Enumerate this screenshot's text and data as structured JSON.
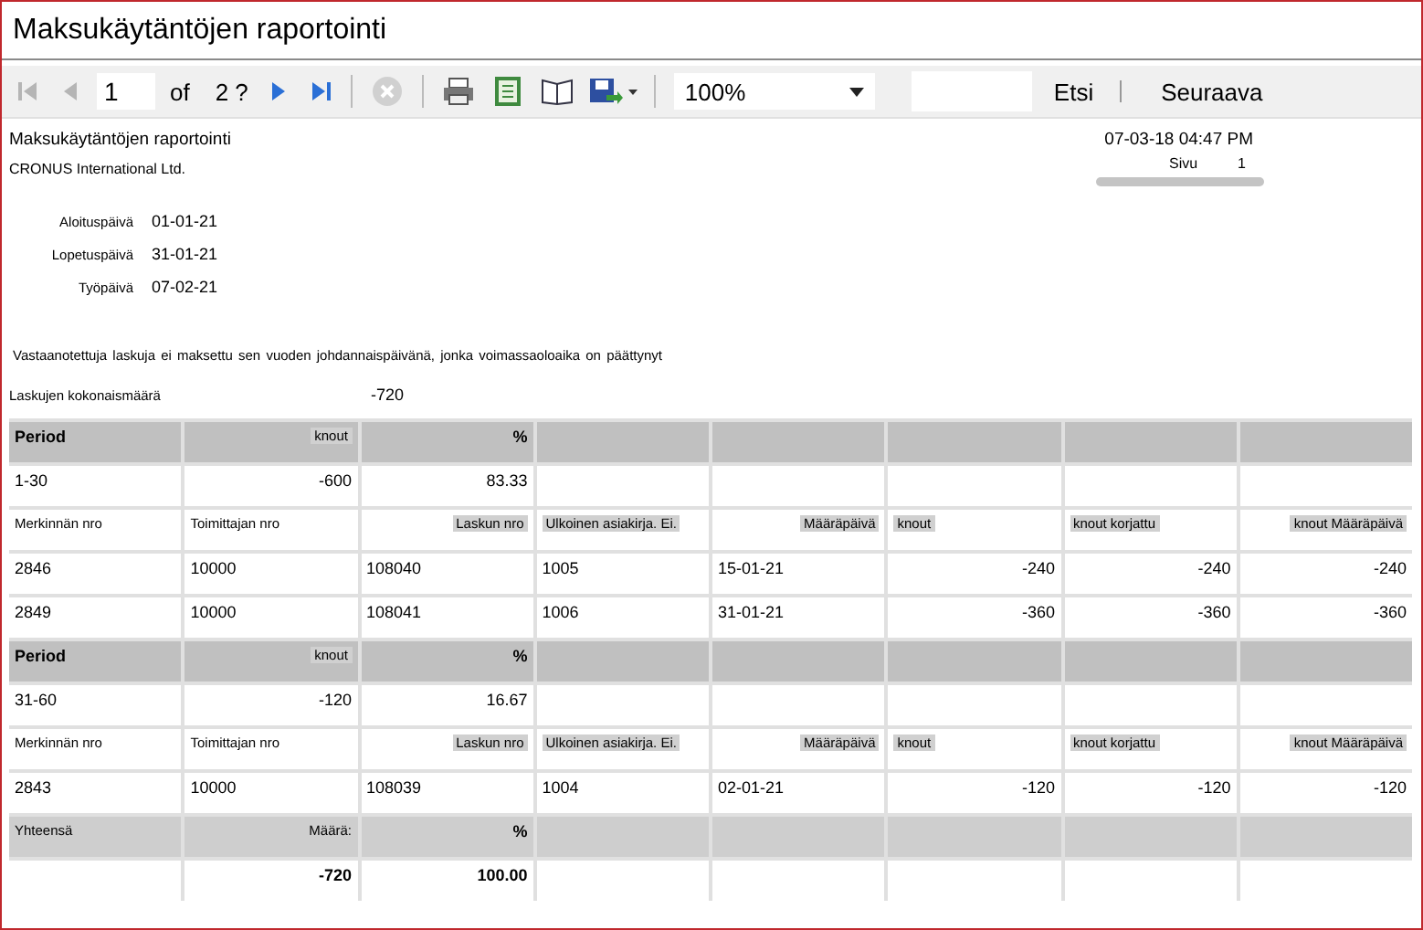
{
  "window": {
    "title": "Maksukäytäntöjen raportointi"
  },
  "toolbar": {
    "nav_back": [
      {
        "kind": "first",
        "disabled": true
      },
      {
        "kind": "prev",
        "disabled": true
      }
    ],
    "page": "1",
    "of_label": "of",
    "page_total": "2 ?",
    "nav_forward": [
      {
        "kind": "next",
        "disabled": false
      },
      {
        "kind": "last",
        "disabled": false
      }
    ],
    "stop": {
      "disabled": true
    },
    "zoom": "100%",
    "find": "Etsi",
    "find_next": "Seuraava"
  },
  "report": {
    "title": "Maksukäytäntöjen raportointi",
    "company": "CRONUS International Ltd.",
    "printed": "07-03-18 04:47 PM",
    "page_label": "Sivu",
    "page": "1",
    "fields": [
      {
        "label": "Aloituspäivä",
        "value": "01-01-21"
      },
      {
        "label": "Lopetuspäivä",
        "value": "31-01-21"
      },
      {
        "label": "Työpäivä",
        "value": "07-02-21"
      }
    ],
    "description": "Vastaanotettuja laskuja ei maksettu sen vuoden johdannaispäivänä, jonka voimassaoloaika on päättynyt",
    "total_label": "Laskujen kokonaismäärä",
    "total_value": "-720",
    "rows": [
      {
        "kind": "group",
        "cells": [
          {
            "text": "Period",
            "bold": true
          },
          {
            "text": "knout",
            "highlight": true,
            "right_aligned": true
          },
          {
            "text": "%",
            "bold": true,
            "right_aligned": true
          }
        ]
      },
      {
        "kind": "data",
        "cells": [
          {
            "text": "1-30"
          },
          {
            "text": "-600",
            "right_aligned": true
          },
          {
            "text": "83.33",
            "right_aligned": true
          }
        ]
      },
      {
        "kind": "header",
        "cells": [
          {
            "text": "Merkinnän nro"
          },
          {
            "text": "Toimittajan nro"
          },
          {
            "text": "Laskun nro",
            "highlight": true,
            "right_aligned": true
          },
          {
            "text": "Ulkoinen asiakirja. Ei.",
            "highlight": true
          },
          {
            "text": "Määräpäivä",
            "highlight": true,
            "right_aligned": true
          },
          {
            "text": "knout",
            "highlight": true
          },
          {
            "text": "knout korjattu",
            "highlight": true
          },
          {
            "text": "knout Määräpäivä",
            "highlight": true,
            "right_aligned": true
          }
        ]
      },
      {
        "kind": "data",
        "cells": [
          {
            "text": "2846"
          },
          {
            "text": "10000"
          },
          {
            "text": "108040"
          },
          {
            "text": "1005"
          },
          {
            "text": "15-01-21"
          },
          {
            "text": "-240",
            "right_aligned": true
          },
          {
            "text": "-240",
            "right_aligned": true
          },
          {
            "text": "-240",
            "right_aligned": true
          }
        ]
      },
      {
        "kind": "data",
        "cells": [
          {
            "text": "2849"
          },
          {
            "text": "10000"
          },
          {
            "text": "108041"
          },
          {
            "text": "1006"
          },
          {
            "text": "31-01-21"
          },
          {
            "text": "-360",
            "right_aligned": true
          },
          {
            "text": "-360",
            "right_aligned": true
          },
          {
            "text": "-360",
            "right_aligned": true
          }
        ]
      },
      {
        "kind": "group",
        "cells": [
          {
            "text": "Period",
            "bold": true
          },
          {
            "text": "knout",
            "highlight": true,
            "right_aligned": true
          },
          {
            "text": "%",
            "bold": true,
            "right_aligned": true
          }
        ]
      },
      {
        "kind": "data",
        "cells": [
          {
            "text": "31-60"
          },
          {
            "text": "-120",
            "right_aligned": true
          },
          {
            "text": "16.67",
            "right_aligned": true
          }
        ]
      },
      {
        "kind": "header",
        "cells": [
          {
            "text": "Merkinnän nro"
          },
          {
            "text": "Toimittajan nro"
          },
          {
            "text": "Laskun nro",
            "highlight": true,
            "right_aligned": true
          },
          {
            "text": "Ulkoinen asiakirja. Ei.",
            "highlight": true
          },
          {
            "text": "Määräpäivä",
            "highlight": true,
            "right_aligned": true
          },
          {
            "text": "knout",
            "highlight": true
          },
          {
            "text": "knout korjattu",
            "highlight": true
          },
          {
            "text": "knout Määräpäivä",
            "highlight": true,
            "right_aligned": true
          }
        ]
      },
      {
        "kind": "data",
        "cells": [
          {
            "text": "2843"
          },
          {
            "text": "10000"
          },
          {
            "text": "108039"
          },
          {
            "text": "1004"
          },
          {
            "text": "02-01-21"
          },
          {
            "text": "-120",
            "right_aligned": true
          },
          {
            "text": "-120",
            "right_aligned": true
          },
          {
            "text": "-120",
            "right_aligned": true
          }
        ]
      },
      {
        "kind": "total",
        "cells": [
          {
            "text": "Yhteensä"
          },
          {
            "text": "Määrä:",
            "right_aligned": true
          },
          {
            "text": "%",
            "bold": true,
            "right_aligned": true
          }
        ]
      },
      {
        "kind": "data",
        "cells": [
          null,
          {
            "text": "-720",
            "bold": true,
            "right_aligned": true
          },
          {
            "text": "100.00",
            "bold": true,
            "right_aligned": true
          }
        ]
      }
    ]
  }
}
